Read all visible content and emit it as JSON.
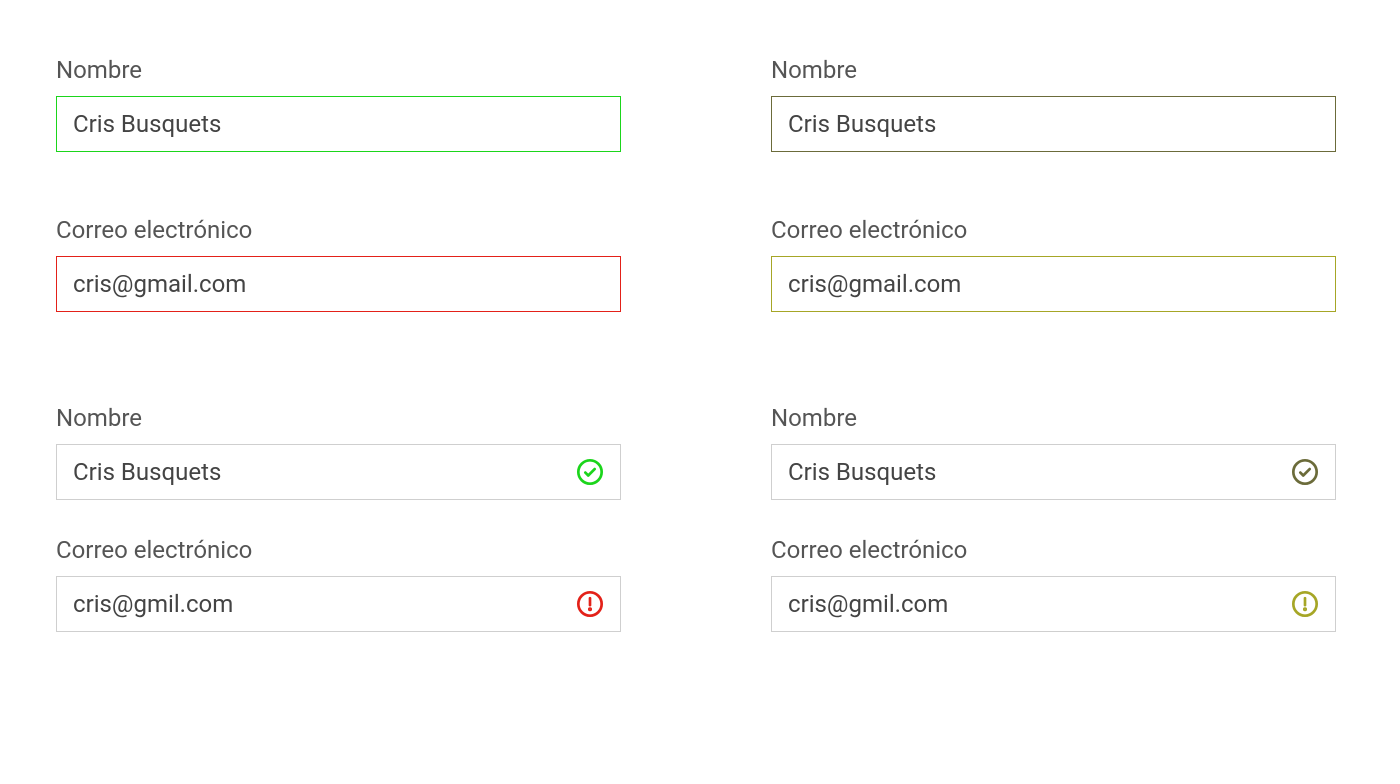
{
  "labels": {
    "name": "Nombre",
    "email": "Correo electrónico"
  },
  "values": {
    "name": "Cris Busquets",
    "email_full": "cris@gmail.com",
    "email_typo": "cris@gmil.com"
  },
  "colors": {
    "green": "#1bd51b",
    "red": "#e32119",
    "olive_dark": "#6b6b3a",
    "olive": "#a6a626",
    "gray": "#cfcfcf"
  }
}
